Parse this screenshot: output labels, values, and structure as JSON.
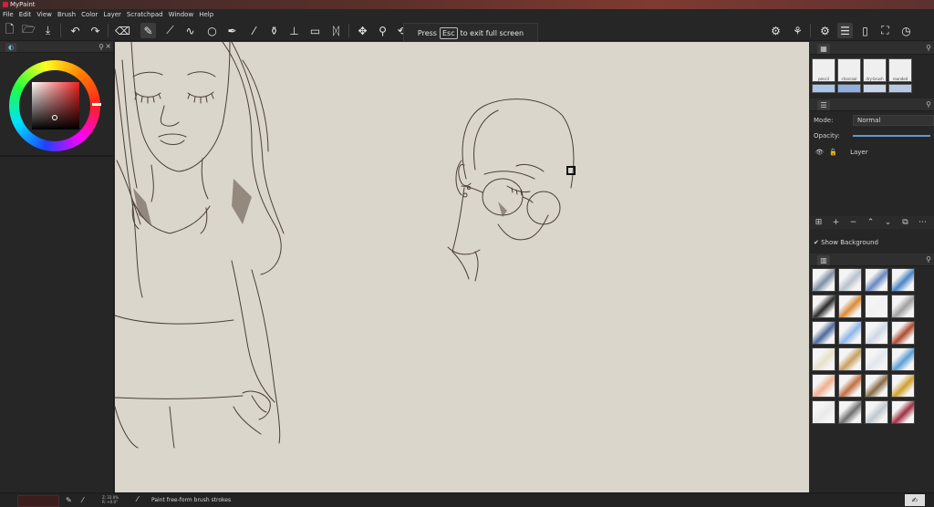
{
  "window": {
    "title": "MyPaint"
  },
  "menu": [
    "File",
    "Edit",
    "View",
    "Brush",
    "Color",
    "Layer",
    "Scratchpad",
    "Window",
    "Help"
  ],
  "toast": {
    "before": "Press",
    "key": "Esc",
    "after": "to exit full screen"
  },
  "layers": {
    "mode_label": "Mode:",
    "mode_value": "Normal",
    "opacity_label": "Opacity:",
    "opacity": 1.0,
    "layer_name": "Layer",
    "show_background_label": "Show Background"
  },
  "brushes": {
    "top_row": [
      "pencil",
      "charcoal",
      "dry-brush",
      "rounded"
    ]
  },
  "status": {
    "message": "Paint free-form brush strokes",
    "coords_line1": "Z: 33.0%",
    "coords_line2": "R: +0.0°",
    "color": "#3a1e1e"
  },
  "colors": {
    "canvas": "#dbd6cb",
    "panel": "#262626",
    "accent": "#5a9ad6"
  }
}
